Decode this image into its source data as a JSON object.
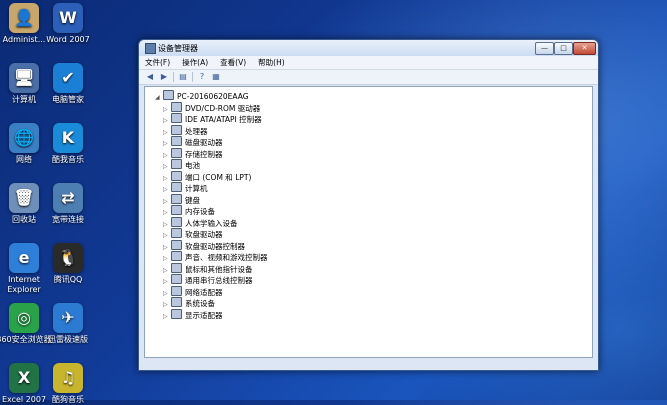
{
  "desktop": {
    "icons": [
      {
        "label": "Administ...",
        "glyph": "👤",
        "color": "#c9a66b"
      },
      {
        "label": "Word 2007",
        "glyph": "W",
        "color": "#2b5fb8"
      },
      {
        "label": "计算机",
        "glyph": "🖥",
        "color": "#4a6ea8"
      },
      {
        "label": "电脑管家",
        "glyph": "✔",
        "color": "#1c7fd6"
      },
      {
        "label": "网络",
        "glyph": "🌐",
        "color": "#3a7fc4"
      },
      {
        "label": "酷我音乐",
        "glyph": "K",
        "color": "#1a8bd8"
      },
      {
        "label": "回收站",
        "glyph": "🗑",
        "color": "#6d8fb9"
      },
      {
        "label": "宽带连接",
        "glyph": "⇄",
        "color": "#4d7fb3"
      },
      {
        "label": "Internet Explorer",
        "glyph": "e",
        "color": "#2e7fd8"
      },
      {
        "label": "腾讯QQ",
        "glyph": "🐧",
        "color": "#2a2a2a"
      },
      {
        "label": "360安全浏览器",
        "glyph": "◎",
        "color": "#29a24a"
      },
      {
        "label": "迅雷极速版",
        "glyph": "✈",
        "color": "#2b7bd3"
      },
      {
        "label": "Excel 2007",
        "glyph": "X",
        "color": "#217346"
      },
      {
        "label": "酷狗音乐",
        "glyph": "♫",
        "color": "#c8b52e"
      }
    ]
  },
  "window": {
    "title": "设备管理器",
    "min_label": "—",
    "max_label": "□",
    "close_label": "✕",
    "menus": [
      "文件(F)",
      "操作(A)",
      "查看(V)",
      "帮助(H)"
    ],
    "root": "PC-20160620EAAG",
    "devices": [
      "DVD/CD-ROM 驱动器",
      "IDE ATA/ATAPI 控制器",
      "处理器",
      "磁盘驱动器",
      "存储控制器",
      "电池",
      "端口 (COM 和 LPT)",
      "计算机",
      "键盘",
      "内存设备",
      "人体学输入设备",
      "软盘驱动器",
      "软盘驱动器控制器",
      "声音、视频和游戏控制器",
      "鼠标和其他指针设备",
      "通用串行总线控制器",
      "网络适配器",
      "系统设备",
      "显示适配器"
    ]
  }
}
